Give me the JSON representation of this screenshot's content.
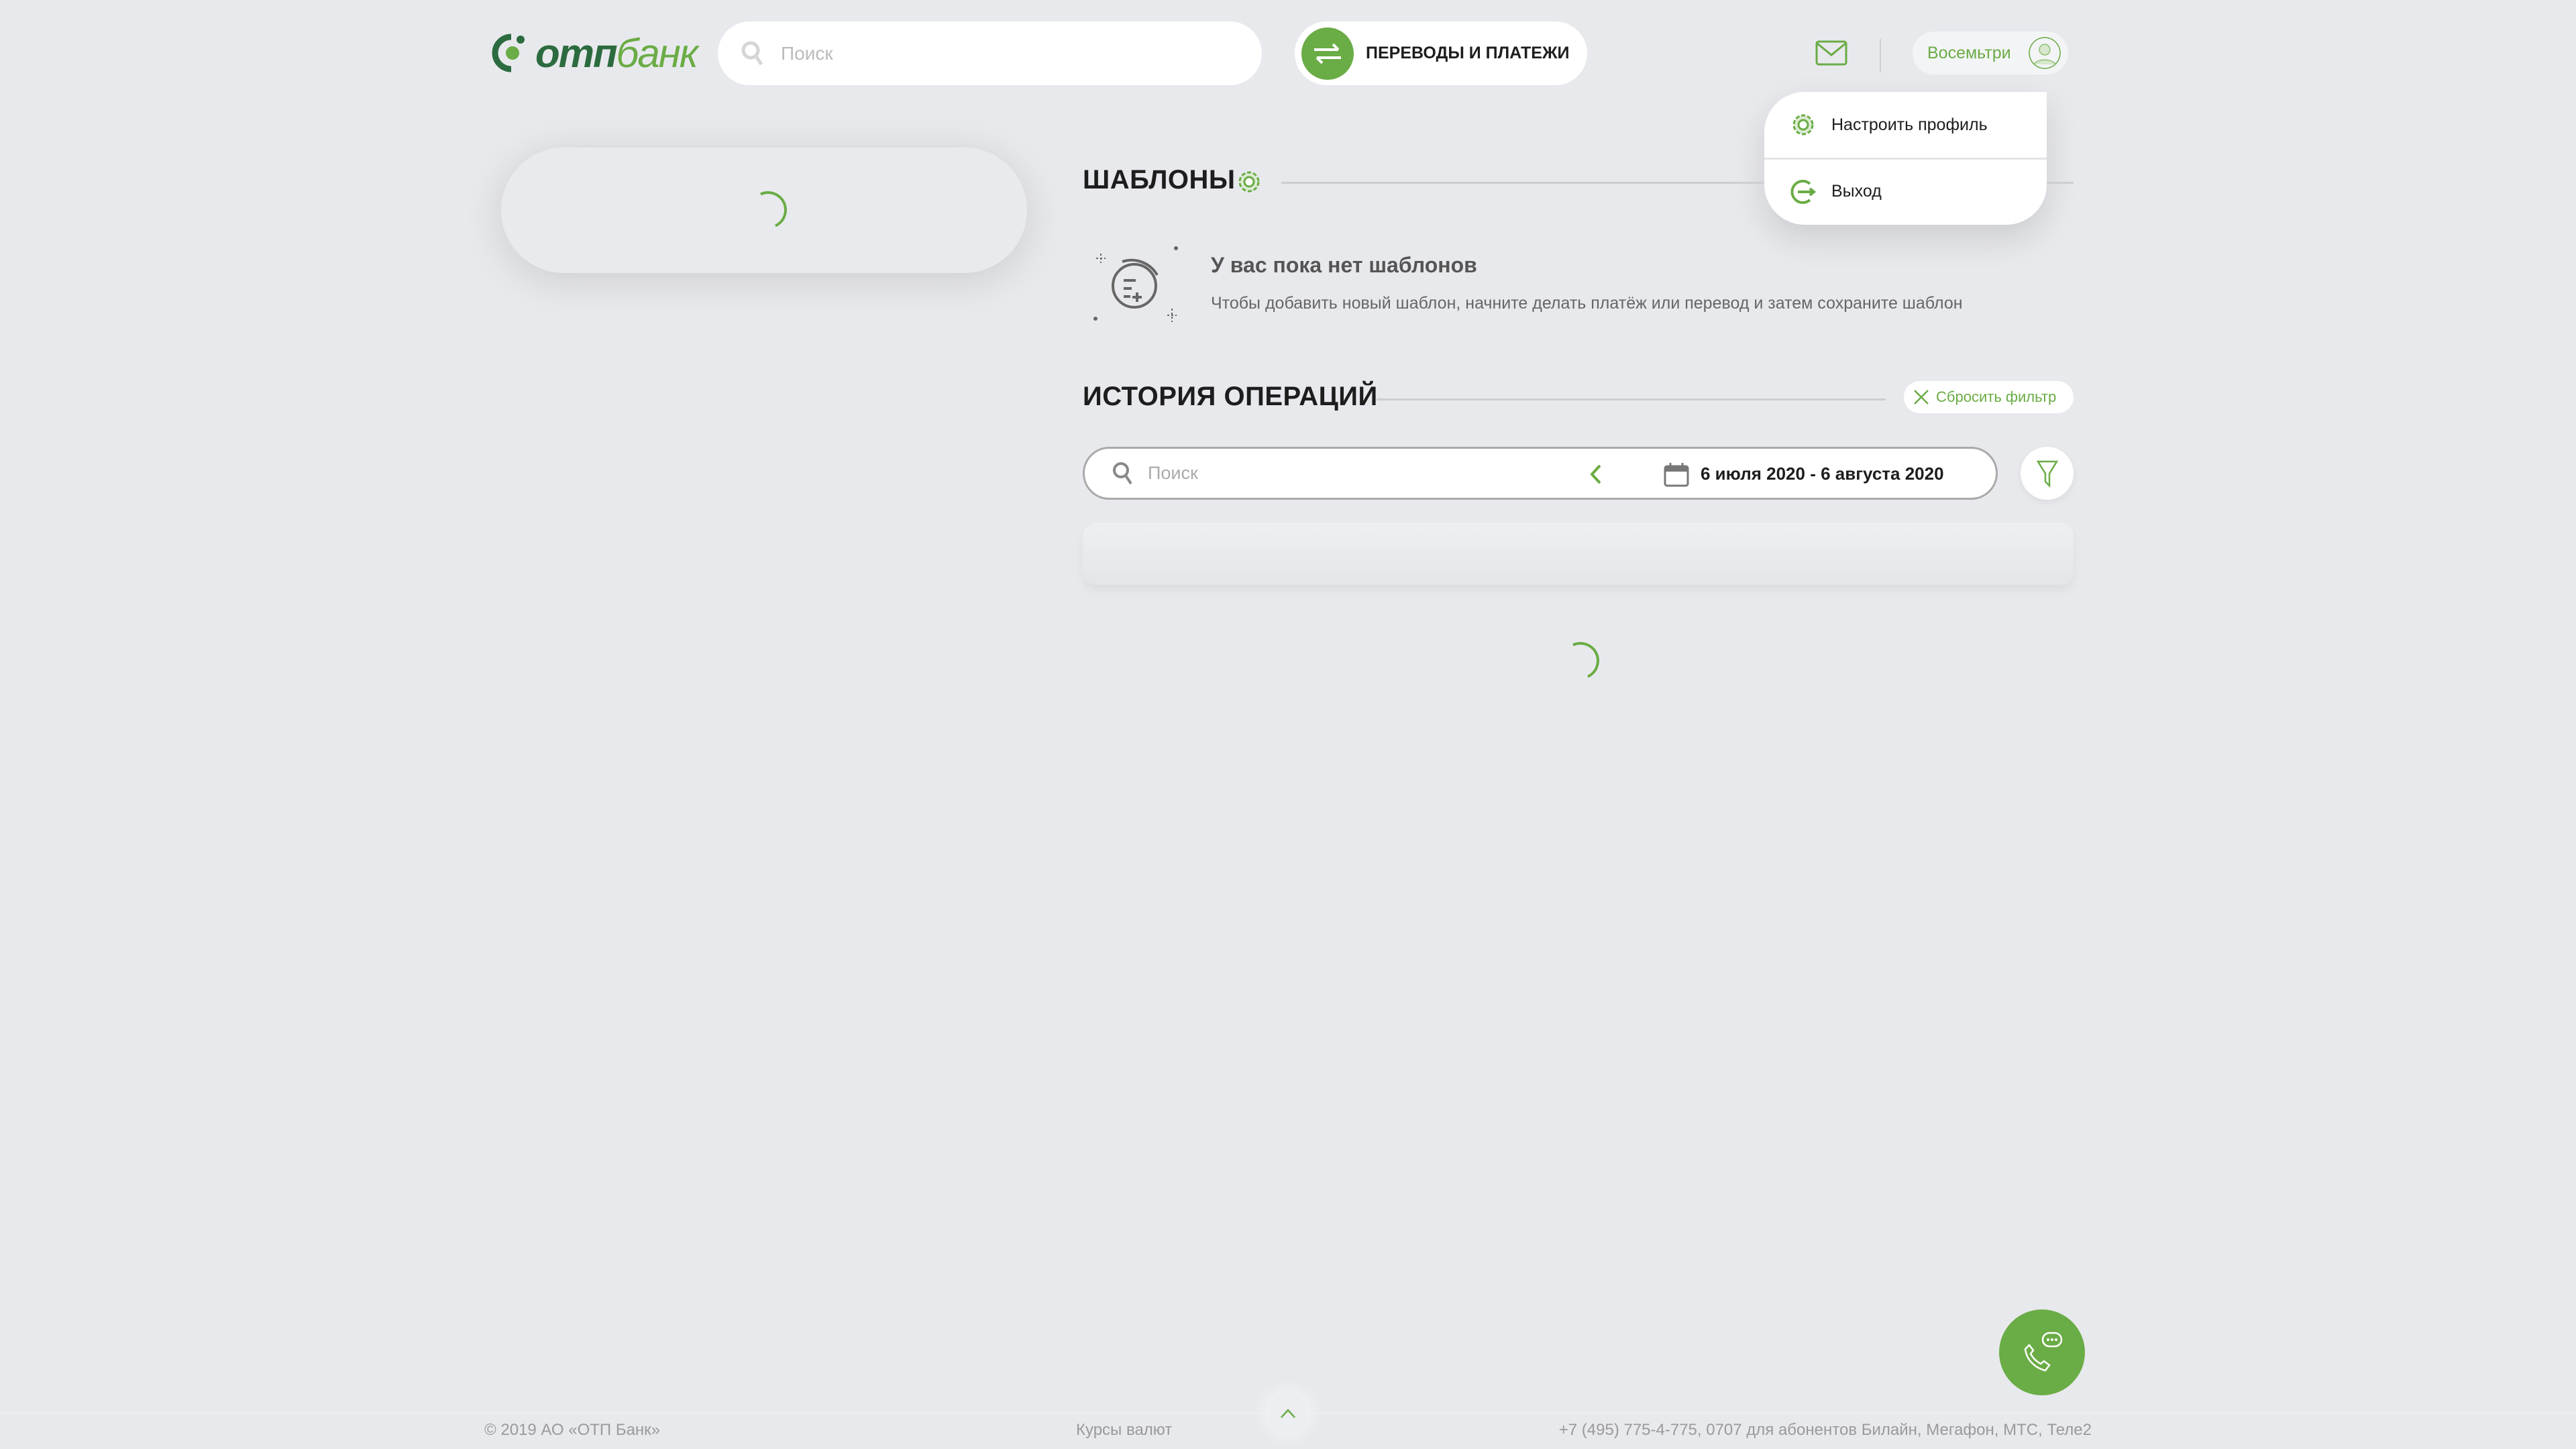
{
  "header": {
    "logo": {
      "part1": "отп",
      "part2": "банк"
    },
    "search_placeholder": "Поиск",
    "transfers_label": "ПЕРЕВОДЫ И ПЛАТЕЖИ",
    "user_name": "Восемьтри"
  },
  "user_menu": [
    {
      "label": "Настроить профиль",
      "icon": "gear-icon"
    },
    {
      "label": "Выход",
      "icon": "logout-icon"
    }
  ],
  "templates": {
    "title": "ШАБЛОНЫ",
    "empty_title": "У вас пока нет шаблонов",
    "empty_desc": "Чтобы добавить новый шаблон, начните делать платёж или перевод и затем сохраните шаблон"
  },
  "history": {
    "title": "ИСТОРИЯ ОПЕРАЦИЙ",
    "reset_filter": "Сбросить фильтр",
    "search_placeholder": "Поиск",
    "date_range": "6 июля 2020 - 6 августа 2020"
  },
  "footer": {
    "copyright": "© 2019 АО «ОТП Банк»",
    "rates": "Курсы валют",
    "phones": "+7 (495) 775-4-775,  0707 для абонентов Билайн, Мегафон, МТС, Теле2"
  },
  "colors": {
    "accent": "#6aac45",
    "brand_dark": "#2c6b3f",
    "background": "#e8e9ed"
  }
}
